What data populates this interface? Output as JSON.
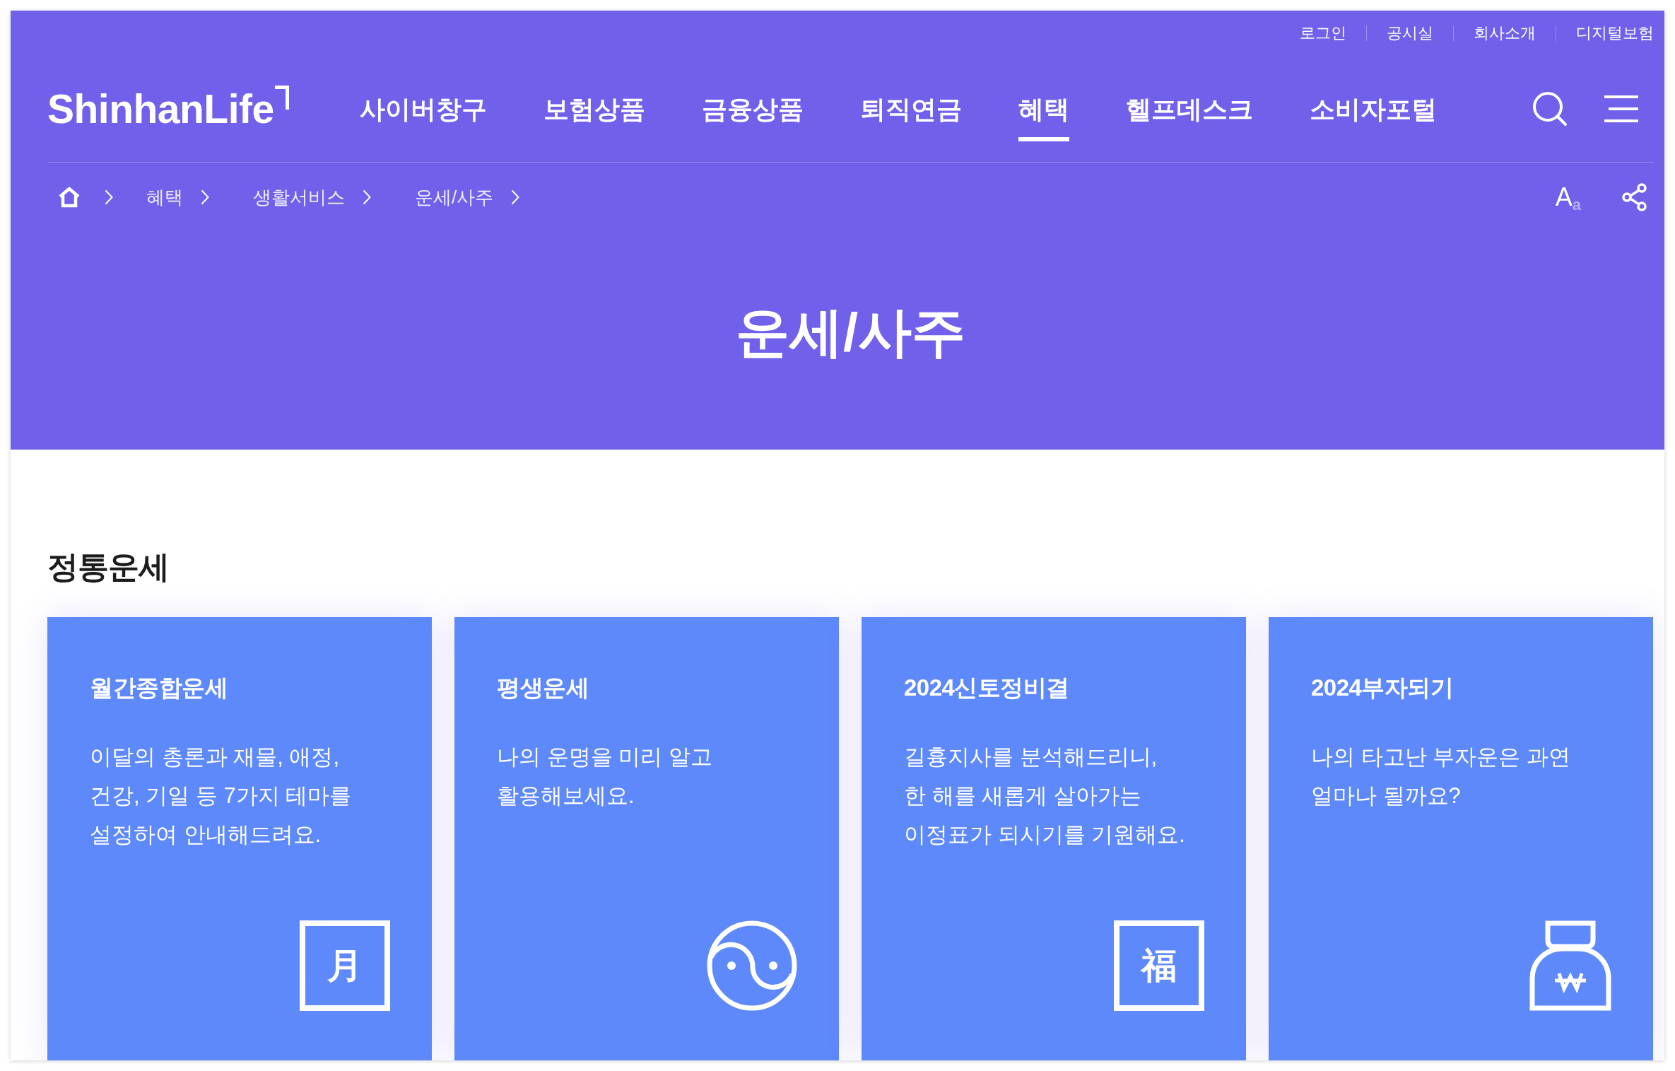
{
  "utility_links": [
    "로그인",
    "공시실",
    "회사소개",
    "디지털보험"
  ],
  "logo": "ShinhanLife",
  "nav": [
    {
      "label": "사이버창구",
      "selected": false
    },
    {
      "label": "보험상품",
      "selected": false
    },
    {
      "label": "금융상품",
      "selected": false
    },
    {
      "label": "퇴직연금",
      "selected": false
    },
    {
      "label": "혜택",
      "selected": true
    },
    {
      "label": "헬프데스크",
      "selected": false
    },
    {
      "label": "소비자포털",
      "selected": false
    }
  ],
  "breadcrumb": [
    "혜택",
    "생활서비스",
    "운세/사주"
  ],
  "text_size_button": "A$_{a}$",
  "page_title": "운세/사주",
  "section": {
    "title": "정통운세",
    "cards": [
      {
        "title": "월간종합운세",
        "description": [
          "이달의 총론과 재물, 애정,",
          "건강, 기일 등 7가지 테마를",
          "설정하여 안내해드려요."
        ],
        "icon": {
          "kind": "tile",
          "text": "月"
        }
      },
      {
        "title": "평생운세",
        "description": [
          "나의 운명을 미리 알고",
          "활용해보세요."
        ],
        "icon": {
          "kind": "yinyang"
        }
      },
      {
        "title": "2024신토정비결",
        "description": [
          "길흉지사를 분석해드리니,",
          "한 해를 새롭게 살아가는",
          "이정표가 되시기를 기원해요."
        ],
        "icon": {
          "kind": "tile",
          "text": "福"
        }
      },
      {
        "title": "2024부자되기",
        "description": [
          "나의 타고난 부자운은 과연",
          "얼마나 될까요?"
        ],
        "icon": {
          "kind": "bag"
        }
      }
    ]
  }
}
